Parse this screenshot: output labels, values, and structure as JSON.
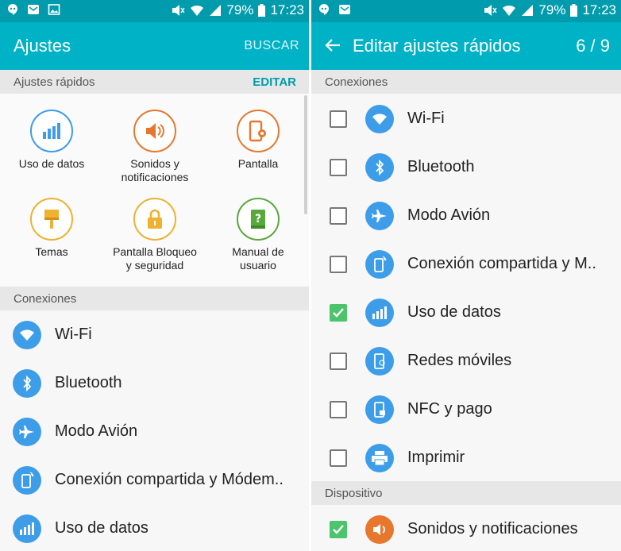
{
  "status_bar": {
    "battery": "79%",
    "time": "17:23"
  },
  "left": {
    "app_title": "Ajustes",
    "search_label": "BUSCAR",
    "quick_settings": {
      "header": "Ajustes rápidos",
      "edit_label": "EDITAR",
      "tiles": [
        {
          "label": "Uso de datos",
          "icon": "data-usage-icon",
          "color": "#3d9de8"
        },
        {
          "label": "Sonidos y\nnotificaciones",
          "icon": "speaker-icon",
          "color": "#e8772e"
        },
        {
          "label": "Pantalla",
          "icon": "display-settings-icon",
          "color": "#e8772e"
        },
        {
          "label": "Temas",
          "icon": "paintbrush-icon",
          "color": "#f0b030"
        },
        {
          "label": "Pantalla Bloqueo\ny seguridad",
          "icon": "lock-icon",
          "color": "#f0b030"
        },
        {
          "label": "Manual de\nusuario",
          "icon": "manual-book-icon",
          "color": "#58a83c"
        }
      ]
    },
    "connections": {
      "header": "Conexiones",
      "items": [
        {
          "label": "Wi-Fi",
          "icon": "wifi-icon"
        },
        {
          "label": "Bluetooth",
          "icon": "bluetooth-icon"
        },
        {
          "label": "Modo Avión",
          "icon": "airplane-icon"
        },
        {
          "label": "Conexión compartida y Módem..",
          "icon": "tethering-icon"
        },
        {
          "label": "Uso de datos",
          "icon": "data-usage-icon"
        }
      ]
    }
  },
  "right": {
    "title": "Editar ajustes rápidos",
    "counter": "6 / 9",
    "connections_header": "Conexiones",
    "items": [
      {
        "label": "Wi-Fi",
        "icon": "wifi-icon",
        "checked": false
      },
      {
        "label": "Bluetooth",
        "icon": "bluetooth-icon",
        "checked": false
      },
      {
        "label": "Modo Avión",
        "icon": "airplane-icon",
        "checked": false
      },
      {
        "label": "Conexión compartida y M..",
        "icon": "tethering-icon",
        "checked": false
      },
      {
        "label": "Uso de datos",
        "icon": "data-usage-icon",
        "checked": true
      },
      {
        "label": "Redes móviles",
        "icon": "mobile-networks-icon",
        "checked": false
      },
      {
        "label": "NFC y pago",
        "icon": "nfc-icon",
        "checked": false
      },
      {
        "label": "Imprimir",
        "icon": "printer-icon",
        "checked": false
      }
    ],
    "device_header": "Dispositivo",
    "device_items": [
      {
        "label": "Sonidos y notificaciones",
        "icon": "speaker-icon",
        "checked": true,
        "color": "#e8772e"
      }
    ]
  },
  "colors": {
    "status_bar": "#009cad",
    "app_bar": "#00b2c5",
    "accent": "#009cad",
    "icon_blue": "#3d9de8",
    "check_green": "#4cc46b"
  }
}
